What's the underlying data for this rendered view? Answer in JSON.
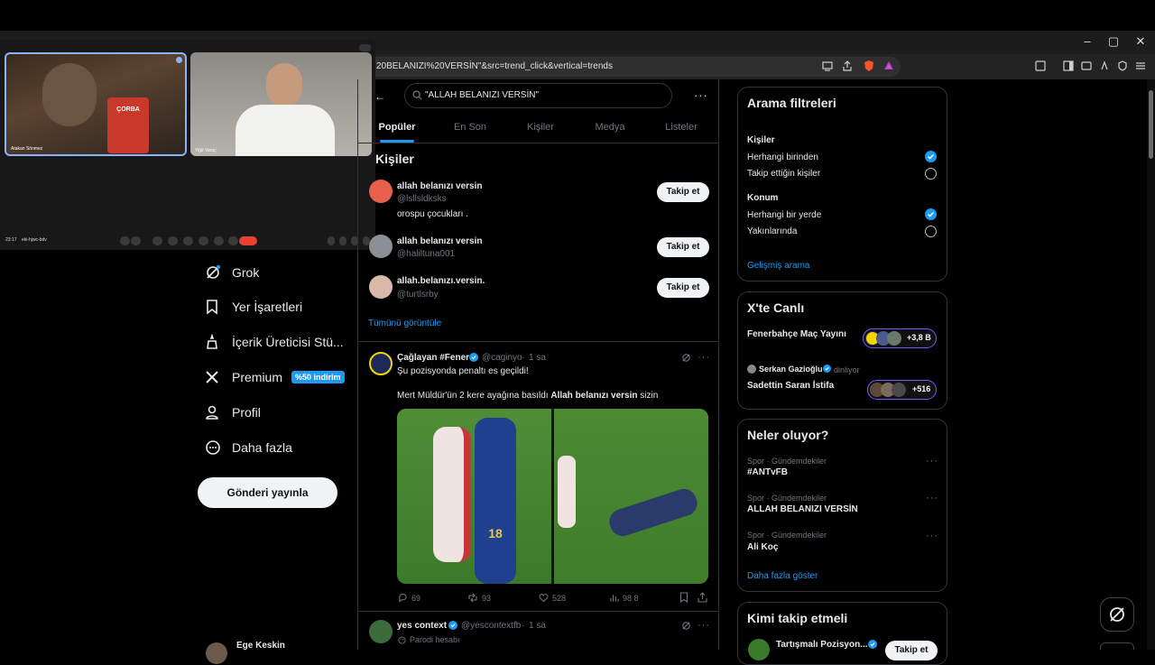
{
  "browser": {
    "url_fragment": "20BELANIZI%20VERSİN\"&src=trend_click&vertical=trends",
    "window_controls": [
      "–",
      "▢",
      "✕"
    ]
  },
  "call": {
    "participant1": "Atakan Sönmez",
    "participant2": "Yiğit Varuç",
    "time": "23:17",
    "code": "eki-hjwc-bdv",
    "cup_text": "ÇORBA"
  },
  "nav": {
    "items": [
      {
        "label": "Grok",
        "icon": "grok-icon"
      },
      {
        "label": "Yer İşaretleri",
        "icon": "bookmark-icon"
      },
      {
        "label": "İçerik Üreticisi Stü...",
        "icon": "creator-studio-icon"
      },
      {
        "label": "Premium",
        "icon": "x-logo-icon"
      },
      {
        "label": "Profil",
        "icon": "person-icon"
      },
      {
        "label": "Daha fazla",
        "icon": "more-circle-icon"
      }
    ],
    "premium_badge": "%50 indirim",
    "post_button": "Gönderi yayınla",
    "account_name": "Ege Keskin"
  },
  "search": {
    "query": "\"ALLAH BELANIZI VERSİN\"",
    "tabs": [
      "Popüler",
      "En Son",
      "Kişiler",
      "Medya",
      "Listeler"
    ],
    "active_tab": 0
  },
  "people": {
    "title": "Kişiler",
    "users": [
      {
        "name": "allah belanızı versin",
        "handle": "@lsllsldksks",
        "bio": "orospu çocukları .",
        "follow": "Takip et",
        "avatar_color": "#e8604c"
      },
      {
        "name": "allah belanızı versin",
        "handle": "@haliltuna001",
        "bio": "",
        "follow": "Takip et",
        "avatar_color": "#8a9096"
      },
      {
        "name": "allah.belanızı.versin.",
        "handle": "@turtlsrby",
        "bio": "",
        "follow": "Takip et",
        "avatar_color": "#d9b8a8"
      }
    ],
    "see_all": "Tümünü görüntüle"
  },
  "tweets": [
    {
      "name": "Çağlayan #Fener",
      "handle": "@caginyo",
      "time": "1 sa",
      "line1": "Şu pozisyonda penaltı es geçildi!",
      "line2_pre": "Mert Müldür'ün 2 kere ayağına basıldı ",
      "line2_bold": "Allah belanızı versin",
      "line2_post": " sizin",
      "media_left_number": "18",
      "stats": {
        "replies": "69",
        "retweets": "93",
        "likes": "528",
        "views": "98 8"
      }
    },
    {
      "name": "yes context",
      "handle": "@yescontextfb",
      "time": "1 sa",
      "subtitle": "Parodi hesabı"
    }
  ],
  "right": {
    "filters": {
      "title": "Arama filtreleri",
      "people_label": "Kişiler",
      "people_opts": [
        {
          "label": "Herhangi birinden",
          "checked": true
        },
        {
          "label": "Takip ettiğin kişiler",
          "checked": false
        }
      ],
      "location_label": "Konum",
      "location_opts": [
        {
          "label": "Herhangi bir yerde",
          "checked": true
        },
        {
          "label": "Yakınlarında",
          "checked": false
        }
      ],
      "advanced": "Gelişmiş arama"
    },
    "live": {
      "title": "X'te Canlı",
      "items": [
        {
          "title": "Fenerbahçe Maç Yayını",
          "count": "+3,8 B"
        },
        {
          "host": "Serkan Gazioğlu",
          "status": "dinliyor",
          "title": "Sadettin Saran İstifa",
          "count": "+516"
        }
      ]
    },
    "trends": {
      "title": "Neler oluyor?",
      "items": [
        {
          "meta": "Spor · Gündemdekiler",
          "title": "#ANTvFB"
        },
        {
          "meta": "Spor · Gündemdekiler",
          "title": "ALLAH BELANIZI VERSİN"
        },
        {
          "meta": "Spor · Gündemdekiler",
          "title": "Ali Koç"
        }
      ],
      "more": "Daha fazla göster"
    },
    "who": {
      "title": "Kimi takip etmeli",
      "first_name": "Tartışmalı Pozisyon...",
      "follow": "Takip et"
    }
  },
  "colors": {
    "accent": "#1d9bf0",
    "border": "#2f3336",
    "muted": "#71767b"
  }
}
